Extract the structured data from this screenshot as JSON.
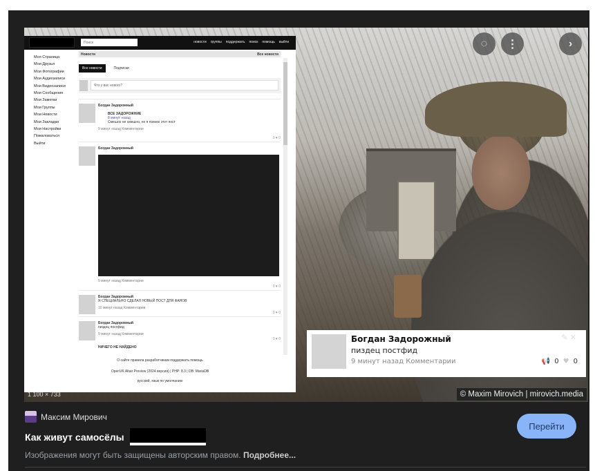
{
  "controls": {
    "lens_icon": "lens-icon",
    "more_icon": "more-vert-icon",
    "next_icon": "chevron-right-icon"
  },
  "inner": {
    "search_placeholder": "Поиск",
    "nav": [
      "новости",
      "группы",
      "поддержать",
      "поиск",
      "помощь",
      "выйти"
    ],
    "sidebar": [
      "Моя Страница",
      "Мои Друзья",
      "Мои Фотографии",
      "Мои Аудиозаписи",
      "Мои Видеозаписи",
      "Мои Сообщения",
      "Мои Заметки",
      "Мои Группы",
      "Мои Новости",
      "Мои Закладки",
      "Мои Настройки",
      "Пожаловаться",
      "Выйти"
    ],
    "feed_title": "Новости",
    "feed_all": "Все новости",
    "tabs": [
      "Все новости",
      "Подписки"
    ],
    "compose_placeholder": "Что у вас нового?",
    "posts": [
      {
        "author": "Богдан Задорожный",
        "repost_title": "ВСЕ ЗАДОРОЖНИЕ",
        "repost_sub": "8 минут назад",
        "text": "Смешно не смешно, но я помню этот пост",
        "meta": "9 минут назад Комментарии",
        "likes": "0 ♥ 0"
      },
      {
        "author": "Богдан Задорожный",
        "meta": "9 минут назад Комментарии",
        "likes": "0 ♥ 0"
      },
      {
        "author": "Богдан Задорожный",
        "text": "Я СПЕЦИАЛЬНО СДЕЛАЛ НОВЫЙ ПОСТ ДЛЯ ФАНОВ",
        "meta": "10 минут назад Комментарии",
        "likes": "0 ♥ 0"
      },
      {
        "author": "Богдан Задорожный",
        "text": "пиздец постфид",
        "meta": "9 минут назад Комментарии",
        "likes": "0 ♥ 0"
      }
    ],
    "more": "НИЧЕГО НЕ НАЙДЕНО",
    "footer_links": "О сайте   правила   разработчикам   поддержать   помощь",
    "footer_version": "OpenVK Altair Preview (2024 версия) | PHP: 8.3 | DB: MariaDB",
    "footer_lang": "русский, язык по умолчанию"
  },
  "card": {
    "name": "Богдан Задорожный",
    "text": "пиздец постфид",
    "meta": "9 минут назад Комментарии",
    "reposts": "0",
    "likes": "0"
  },
  "credit": "© Maxim Mirovich | mirovich.media",
  "dimensions": "1 100 × 733",
  "source": "Максим Мирович",
  "title": "Как живут самосёлы",
  "copyright": "Изображения могут быть защищены авторским правом.",
  "more_link": "Подробнее...",
  "visit_button": "Перейти"
}
